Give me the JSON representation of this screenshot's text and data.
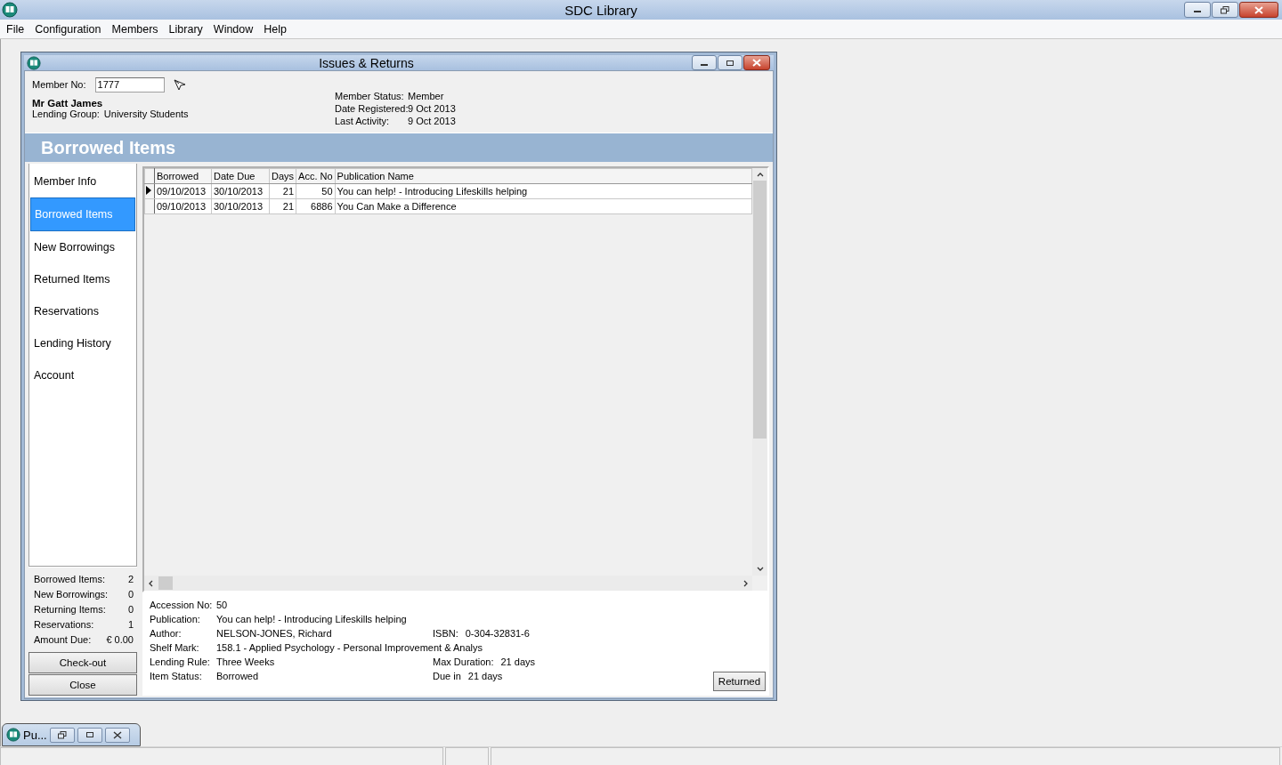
{
  "app": {
    "title": "SDC Library"
  },
  "menu": [
    {
      "label": "File"
    },
    {
      "label": "Configuration"
    },
    {
      "label": "Members"
    },
    {
      "label": "Library"
    },
    {
      "label": "Window"
    },
    {
      "label": "Help"
    }
  ],
  "child_window": {
    "title": "Issues & Returns"
  },
  "member": {
    "label": "Member No:",
    "value": "1777",
    "name": "Mr Gatt James",
    "group_label": "Lending Group:",
    "group": "University Students",
    "status": [
      {
        "label": "Member Status:",
        "value": "Member"
      },
      {
        "label": "Date Registered:",
        "value": "9 Oct 2013"
      },
      {
        "label": "Last Activity:",
        "value": "9 Oct 2013"
      }
    ]
  },
  "section_title": "Borrowed Items",
  "nav": [
    {
      "label": "Member Info",
      "selected": false
    },
    {
      "label": "Borrowed Items",
      "selected": true
    },
    {
      "label": "New Borrowings",
      "selected": false
    },
    {
      "label": "Returned Items",
      "selected": false
    },
    {
      "label": "Reservations",
      "selected": false
    },
    {
      "label": "Lending History",
      "selected": false
    },
    {
      "label": "Account",
      "selected": false
    }
  ],
  "summary": [
    {
      "label": "Borrowed Items:",
      "value": "2"
    },
    {
      "label": "New Borrowings:",
      "value": "0"
    },
    {
      "label": "Returning Items:",
      "value": "0"
    },
    {
      "label": "Reservations:",
      "value": "1"
    },
    {
      "label": "Amount Due:",
      "value": "€ 0.00"
    }
  ],
  "side_buttons": [
    {
      "label": "Check-out"
    },
    {
      "label": "Close"
    }
  ],
  "table": {
    "columns": [
      {
        "label": "Borrowed",
        "kind": "text"
      },
      {
        "label": "Date Due",
        "kind": "text"
      },
      {
        "label": "Days",
        "kind": "number"
      },
      {
        "label": "Acc. No",
        "kind": "number"
      },
      {
        "label": "Publication Name",
        "kind": "text"
      }
    ],
    "rows": [
      {
        "selected": true,
        "cells": [
          "09/10/2013",
          "30/10/2013",
          "21",
          "50",
          "You can help! - Introducing Lifeskills helping"
        ]
      },
      {
        "selected": false,
        "cells": [
          "09/10/2013",
          "30/10/2013",
          "21",
          "6886",
          "You Can Make a Difference"
        ]
      }
    ]
  },
  "details": [
    {
      "label": "Accession No:",
      "value": "50"
    },
    {
      "label": "Publication:",
      "value": "You can help! - Introducing Lifeskills helping"
    },
    {
      "label": "Author:",
      "value": "NELSON-JONES, Richard",
      "right": {
        "label": "ISBN:",
        "value": "0-304-32831-6"
      }
    },
    {
      "label": "Shelf Mark:",
      "value": "158.1 - Applied Psychology - Personal Improvement & Analys"
    },
    {
      "label": "Lending Rule:",
      "value": "Three Weeks",
      "right": {
        "label": "Max Duration:",
        "value": "21 days"
      }
    },
    {
      "label": "Item Status:",
      "value": "Borrowed",
      "right": {
        "label": "Due in",
        "value": "21 days"
      }
    }
  ],
  "returned_button": {
    "label": "Returned"
  },
  "minimized_window": {
    "title": "Pu..."
  }
}
